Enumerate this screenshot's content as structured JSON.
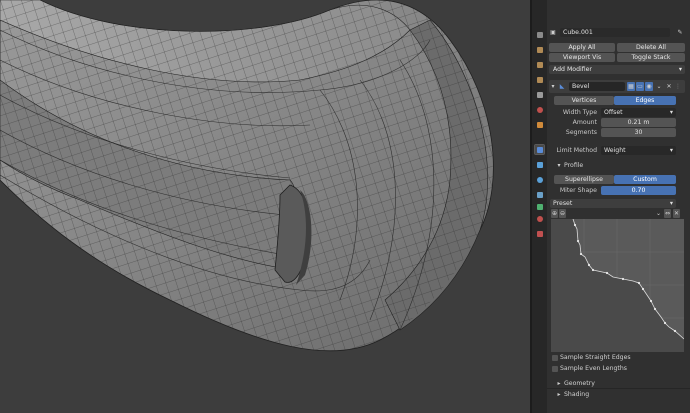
{
  "properties": {
    "object_name": "Cube.001",
    "apply_all": "Apply All",
    "delete_all": "Delete All",
    "viewport_vis": "Viewport Vis",
    "toggle_stack": "Toggle Stack",
    "add_modifier": "Add Modifier",
    "modifier_name": "Bevel",
    "affect_vertices": "Vertices",
    "affect_edges": "Edges",
    "width_type_label": "Width Type",
    "width_type_value": "Offset",
    "amount_label": "Amount",
    "amount_value": "0.21 m",
    "segments_label": "Segments",
    "segments_value": "30",
    "limit_method_label": "Limit Method",
    "limit_method_value": "Weight",
    "profile_header": "Profile",
    "profile_superellipse": "Superellipse",
    "profile_custom": "Custom",
    "miter_shape_label": "Miter Shape",
    "miter_shape_value": "0.70",
    "preset_label": "Preset",
    "sample_straight_edges": "Sample Straight Edges",
    "sample_even_lengths": "Sample Even Lengths",
    "geometry_header": "Geometry",
    "shading_header": "Shading"
  },
  "colors": {
    "accent_blue": "#4772b3",
    "panel_bg": "#303030",
    "viewport_bg": "#3d3d3d",
    "wrench_tab": "#5a8cd8"
  },
  "icons": [
    "wrench-icon",
    "camera-icon",
    "monitor-icon",
    "x-icon",
    "pin-icon",
    "chevron-down-icon",
    "zoom-in-icon",
    "zoom-out-icon",
    "reset-view-icon",
    "clip-icon"
  ]
}
